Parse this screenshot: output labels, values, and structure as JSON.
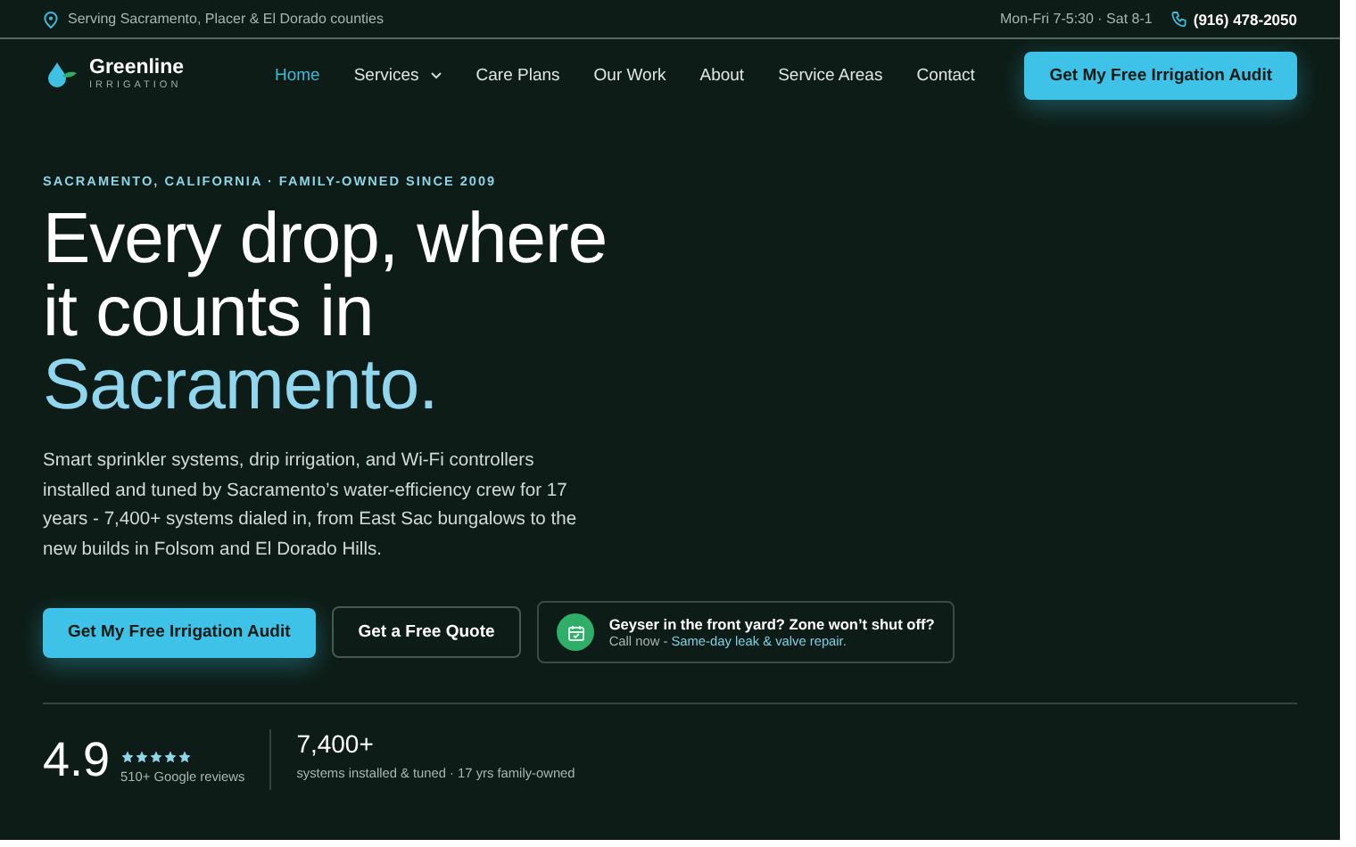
{
  "top_bar": {
    "service_area": "Serving Sacramento, Placer & El Dorado counties",
    "hours": "Mon-Fri 7-5:30 · Sat 8-1",
    "phone": "(916) 478-2050"
  },
  "brand": {
    "name": "Greenline",
    "tagline": "IRRIGATION"
  },
  "nav": [
    {
      "label": "Home",
      "selected": true,
      "kind": "link"
    },
    {
      "label": "Services",
      "selected": false,
      "kind": "dropdown"
    },
    {
      "label": "Care Plans",
      "selected": false,
      "kind": "link"
    },
    {
      "label": "Our Work",
      "selected": false,
      "kind": "link"
    },
    {
      "label": "About",
      "selected": false,
      "kind": "link"
    },
    {
      "label": "Service Areas",
      "selected": false,
      "kind": "link"
    },
    {
      "label": "Contact",
      "selected": false,
      "kind": "link"
    }
  ],
  "nav_cta": "Get My Free Irrigation Audit",
  "hero": {
    "eyebrow": "SACRAMENTO, CALIFORNIA · FAMILY-OWNED SINCE 2009",
    "headline": [
      "Every drop, where",
      "it counts in"
    ],
    "headline_accent": "Sacramento.",
    "description": "Smart sprinkler systems, drip irrigation, and Wi-Fi controllers installed and tuned by Sacramento’s water-efficiency crew for 17 years - 7,400+ systems dialed in, from East Sac bungalows to the new builds in Folsom and El Dorado Hills.",
    "primary_button": "Get My Free Irrigation Audit",
    "secondary_button": "Get a Free Quote",
    "callout": {
      "title": "Geyser in the front yard? Zone won’t shut off?",
      "prefix": "Call now - ",
      "link": "Same-day leak & valve repair."
    }
  },
  "stats": [
    {
      "kind": "rating",
      "value": "4.9",
      "stars": 5,
      "caption": "510+ Google reviews"
    },
    {
      "kind": "count",
      "value": "7,400+",
      "caption": "systems installed & tuned · 17 yrs family-owned"
    }
  ]
}
